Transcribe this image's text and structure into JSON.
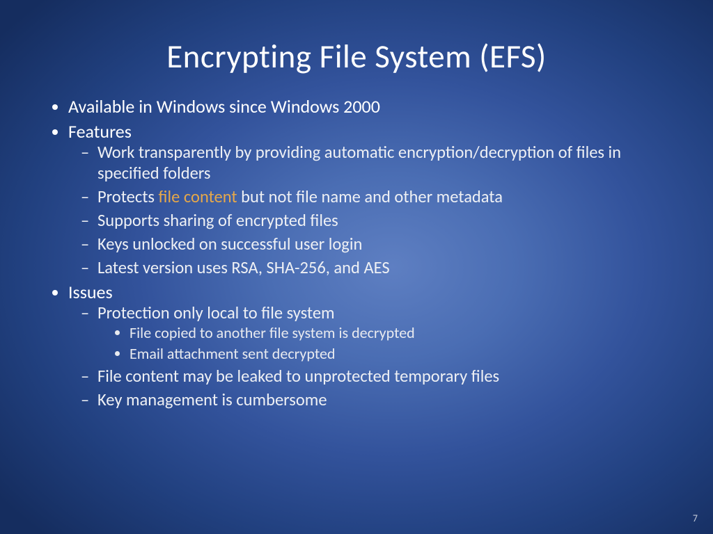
{
  "title": "Encrypting File System (EFS)",
  "bullets": {
    "b1": "Available in Windows since Windows 2000",
    "b2": "Features",
    "b2_1": "Work transparently by providing automatic encryption/decryption of files in specified folders",
    "b2_2_pre": "Protects ",
    "b2_2_hl": "file content",
    "b2_2_post": " but not file name and other metadata",
    "b2_3": "Supports sharing of encrypted files",
    "b2_4": "Keys unlocked on successful user login",
    "b2_5": "Latest version uses RSA, SHA-256, and AES",
    "b3": "Issues",
    "b3_1": "Protection only local to file system",
    "b3_1_1": "File copied to another file system is decrypted",
    "b3_1_2": "Email attachment sent decrypted",
    "b3_2": "File content may be leaked to unprotected temporary files",
    "b3_3": "Key management is cumbersome"
  },
  "page_number": "7"
}
